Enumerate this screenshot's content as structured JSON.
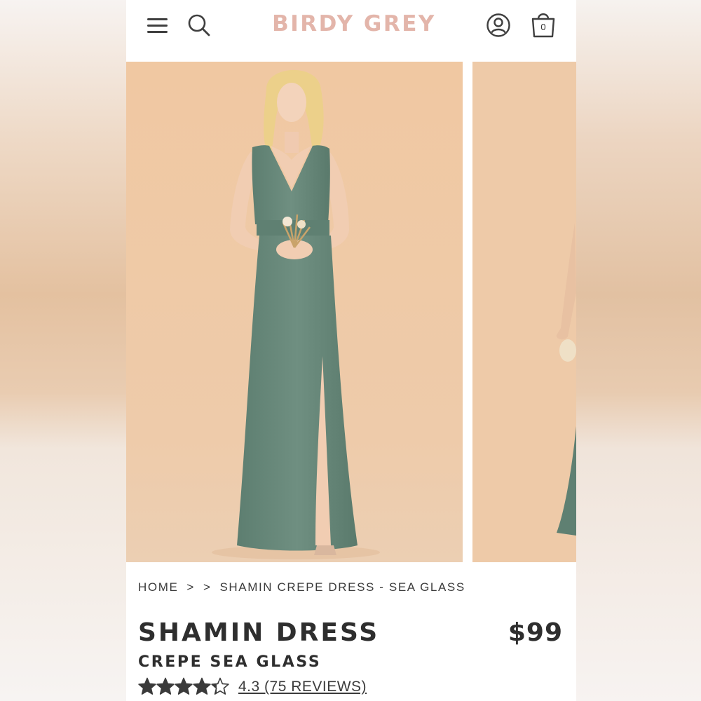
{
  "header": {
    "brand": "BIRDY GREY",
    "cart_count": "0",
    "icons": [
      "hamburger-menu-icon",
      "search-icon",
      "account-icon",
      "shopping-bag-icon"
    ]
  },
  "breadcrumb": {
    "home": "HOME",
    "separator_1": ">",
    "separator_2": ">",
    "current": "SHAMIN CREPE DRESS - SEA GLASS"
  },
  "product": {
    "title": "SHAMIN DRESS",
    "subtitle": "CREPE SEA GLASS",
    "price": "$99",
    "rating_value": 4.3,
    "rating_max": 5,
    "rating_label": "4.3 (75 REVIEWS)"
  },
  "colors": {
    "brand": "#e3b5aa",
    "text": "#2e2e2e",
    "dress": "#6a8a7c",
    "photo_backdrop": "#efcaa6"
  }
}
